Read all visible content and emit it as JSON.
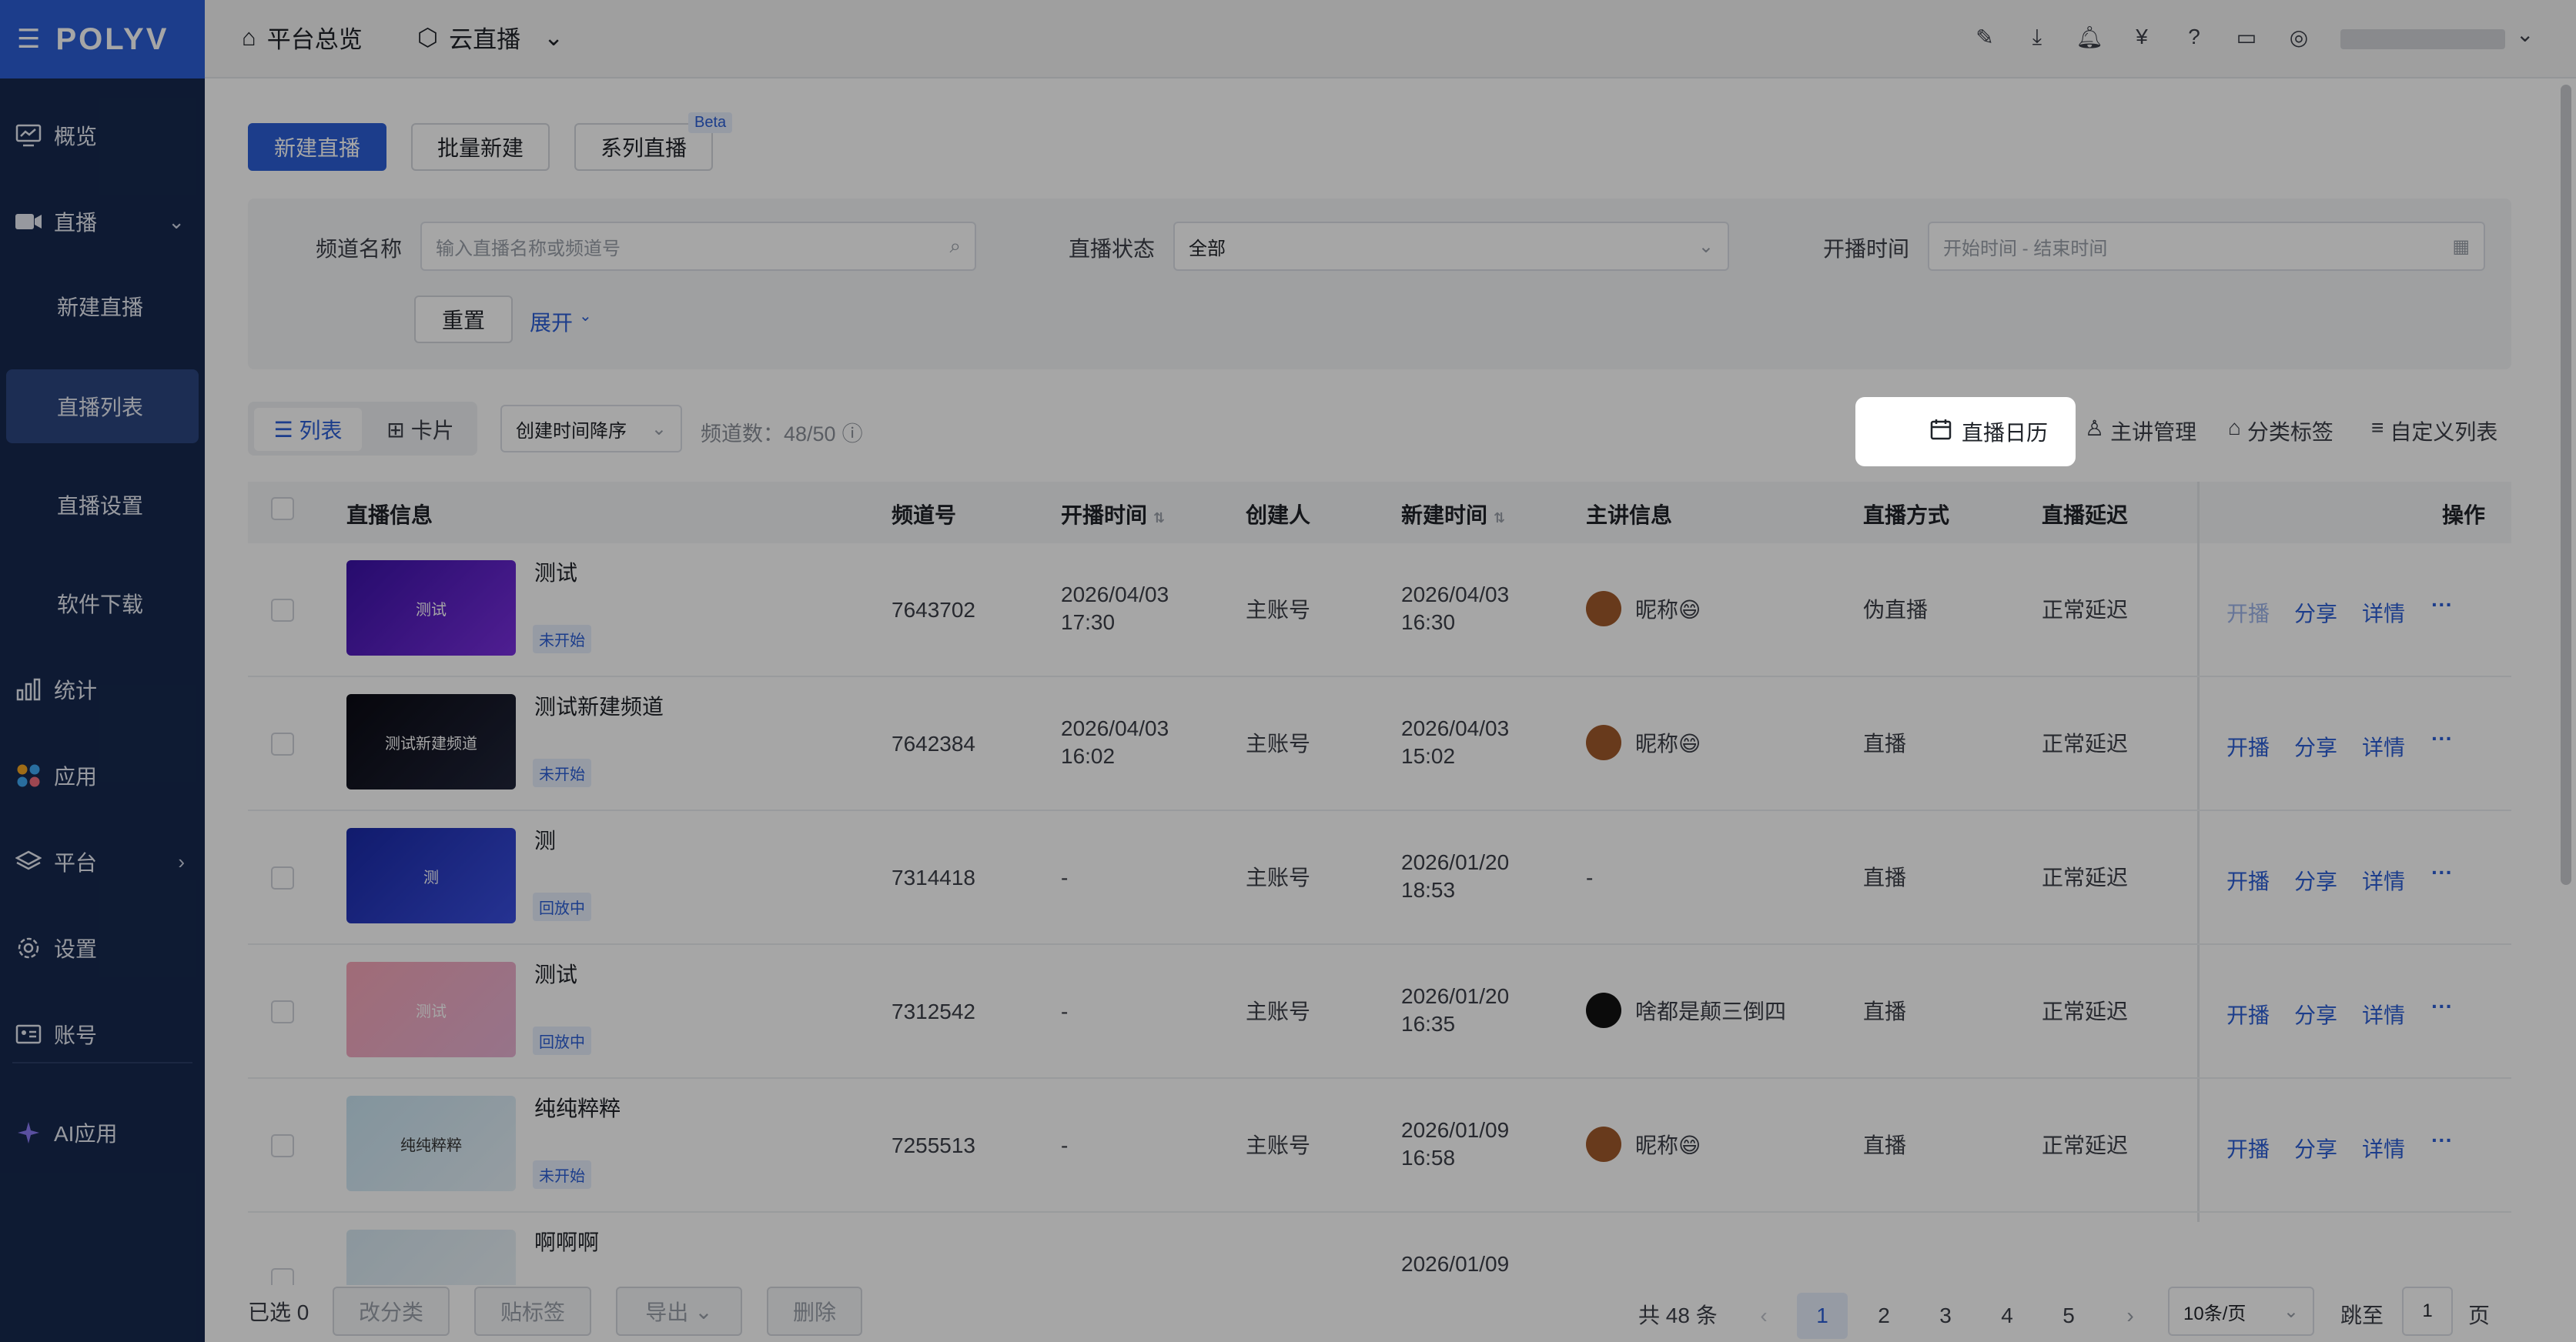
{
  "brand": {
    "logo": "POLYV",
    "accent": "#2b5fd6",
    "sidebar_bg": "#16294f"
  },
  "sidebar": {
    "items": [
      {
        "label": "概览",
        "icon": "monitor-icon"
      },
      {
        "label": "直播",
        "icon": "video-icon"
      },
      {
        "label": "统计",
        "icon": "bar-chart-icon"
      },
      {
        "label": "应用",
        "icon": "apps-icon"
      },
      {
        "label": "平台",
        "icon": "layers-icon"
      },
      {
        "label": "设置",
        "icon": "gear-icon"
      },
      {
        "label": "账号",
        "icon": "id-card-icon"
      },
      {
        "label": "AI应用",
        "icon": "sparkle-icon"
      }
    ],
    "sub_items": [
      "新建直播",
      "直播列表",
      "直播设置",
      "软件下载"
    ]
  },
  "topbar": {
    "home": "平台总览",
    "product": "云直播"
  },
  "actions": {
    "new_live": "新建直播",
    "batch_new": "批量新建",
    "series_live": "系列直播",
    "beta": "Beta"
  },
  "filter": {
    "channel_label": "频道名称",
    "channel_placeholder": "输入直播名称或频道号",
    "status_label": "直播状态",
    "status_value": "全部",
    "time_label": "开播时间",
    "time_placeholder": "开始时间 - 结束时间",
    "reset": "重置",
    "expand": "展开"
  },
  "toolbar": {
    "view_list": "列表",
    "view_card": "卡片",
    "sort": "创建时间降序",
    "channel_count": "频道数：48/50",
    "calendar": "直播日历",
    "speaker": "主讲管理",
    "tags": "分类标签",
    "custom_list": "自定义列表"
  },
  "table": {
    "headers": [
      "直播信息",
      "频道号",
      "开播时间",
      "创建人",
      "新建时间",
      "主讲信息",
      "直播方式",
      "直播延迟",
      "操作"
    ],
    "rows": [
      {
        "name": "测试",
        "thumb": "测试",
        "status": "未开始",
        "channel": "7643702",
        "start1": "2026/04/03",
        "start2": "17:30",
        "creator": "主账号",
        "created1": "2026/04/03",
        "created2": "16:30",
        "speaker": "昵称😄",
        "mode": "伪直播",
        "delay": "正常延迟",
        "ops": [
          "开播",
          "分享",
          "详情"
        ]
      },
      {
        "name": "测试新建频道",
        "thumb": "测试新建频道",
        "status": "未开始",
        "channel": "7642384",
        "start1": "2026/04/03",
        "start2": "16:02",
        "creator": "主账号",
        "created1": "2026/04/03",
        "created2": "15:02",
        "speaker": "昵称😄",
        "mode": "直播",
        "delay": "正常延迟",
        "ops": [
          "开播",
          "分享",
          "详情"
        ]
      },
      {
        "name": "测",
        "thumb": "测",
        "status": "回放中",
        "channel": "7314418",
        "start1": "-",
        "start2": "",
        "creator": "主账号",
        "created1": "2026/01/20",
        "created2": "18:53",
        "speaker": "-",
        "mode": "直播",
        "delay": "正常延迟",
        "ops": [
          "开播",
          "分享",
          "详情"
        ]
      },
      {
        "name": "测试",
        "thumb": "测试",
        "status": "回放中",
        "channel": "7312542",
        "start1": "-",
        "start2": "",
        "creator": "主账号",
        "created1": "2026/01/20",
        "created2": "16:35",
        "speaker": "啥都是颠三倒四",
        "mode": "直播",
        "delay": "正常延迟",
        "ops": [
          "开播",
          "分享",
          "详情"
        ]
      },
      {
        "name": "纯纯粹粹",
        "thumb": "纯纯粹粹",
        "status": "未开始",
        "channel": "7255513",
        "start1": "-",
        "start2": "",
        "creator": "主账号",
        "created1": "2026/01/09",
        "created2": "16:58",
        "speaker": "昵称😄",
        "mode": "直播",
        "delay": "正常延迟",
        "ops": [
          "开播",
          "分享",
          "详情"
        ]
      },
      {
        "name": "啊啊啊",
        "created1": "2026/01/09"
      }
    ]
  },
  "footer": {
    "selected": "已选 0",
    "reclassify": "改分类",
    "tag": "贴标签",
    "export": "导出",
    "delete": "删除",
    "total": "共 48 条",
    "pages": [
      "1",
      "2",
      "3",
      "4",
      "5"
    ],
    "page_size": "10条/页",
    "jump_label": "跳至",
    "jump_value": "1",
    "page_unit": "页"
  }
}
